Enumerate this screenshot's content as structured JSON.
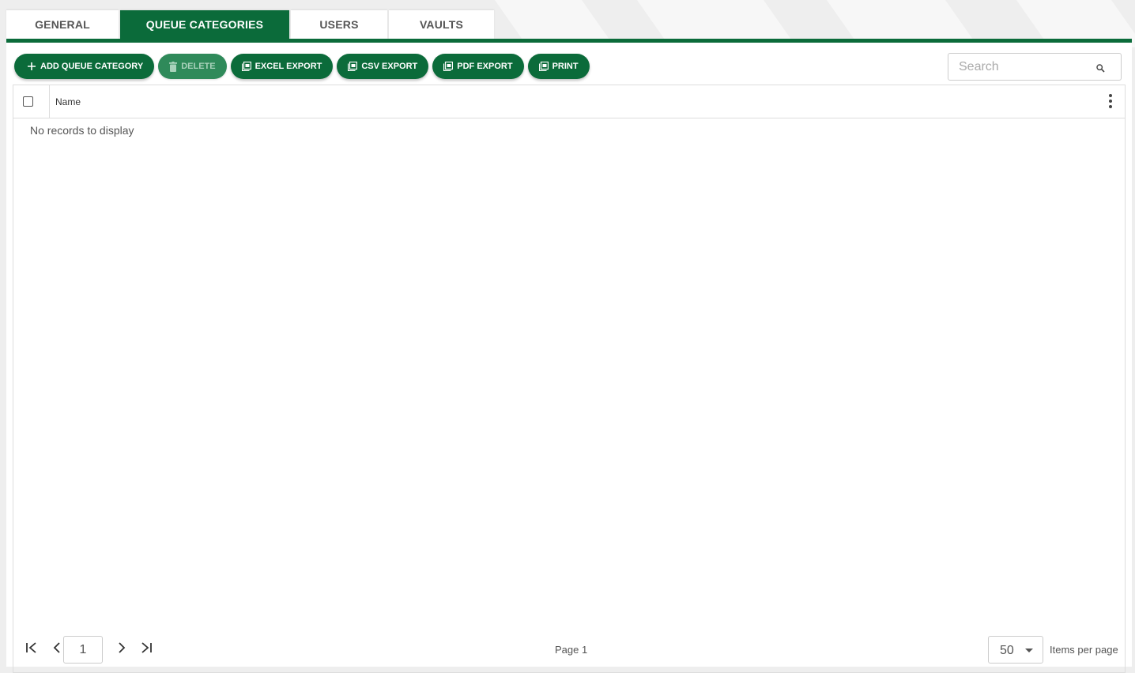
{
  "tabs": [
    {
      "label": "GENERAL"
    },
    {
      "label": "QUEUE CATEGORIES"
    },
    {
      "label": "USERS"
    },
    {
      "label": "VAULTS"
    }
  ],
  "active_tab": "QUEUE CATEGORIES",
  "toolbar": {
    "add_label": "ADD QUEUE CATEGORY",
    "delete_label": "DELETE",
    "excel_label": "EXCEL EXPORT",
    "csv_label": "CSV EXPORT",
    "pdf_label": "PDF EXPORT",
    "print_label": "PRINT"
  },
  "search": {
    "placeholder": "Search",
    "value": ""
  },
  "grid": {
    "columns": [
      "Name"
    ],
    "empty_message": "No records to display"
  },
  "pager": {
    "current_page": "1",
    "page_info": "Page 1",
    "page_size": "50",
    "page_size_label": "Items per page"
  },
  "colors": {
    "accent": "#0b6b3a",
    "disabled_button": "#2f8a5a",
    "background": "#eeeeee"
  },
  "icons": {
    "add": "plus-icon",
    "delete": "trash-icon",
    "export": "export-file-icon",
    "search": "search-icon",
    "menu": "more-vertical-icon",
    "first": "first-page-icon",
    "prev": "chevron-left-icon",
    "next": "chevron-right-icon",
    "last": "last-page-icon"
  }
}
